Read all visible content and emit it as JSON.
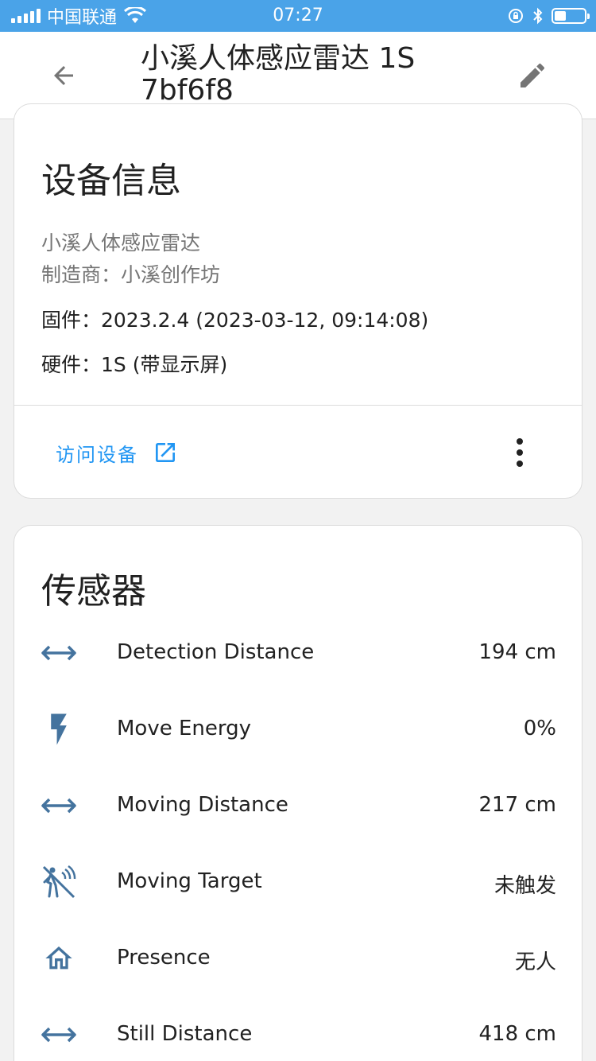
{
  "status_bar": {
    "carrier": "中国联通",
    "time": "07:27"
  },
  "app_bar": {
    "title": "小溪人体感应雷达 1S 7bf6f8"
  },
  "device_info": {
    "title": "设备信息",
    "model": "小溪人体感应雷达",
    "manufacturer": "制造商：小溪创作坊",
    "firmware": "固件：2023.2.4 (2023-03-12, 09:14:08)",
    "hardware": "硬件：1S (带显示屏)",
    "visit_label": "访问设备"
  },
  "sensors": {
    "title": "传感器",
    "items": [
      {
        "icon": "arrow-left-right-icon",
        "name": "Detection Distance",
        "value": "194 cm"
      },
      {
        "icon": "flash-icon",
        "name": "Move Energy",
        "value": "0%"
      },
      {
        "icon": "arrow-left-right-icon",
        "name": "Moving Distance",
        "value": "217 cm"
      },
      {
        "icon": "motion-sensor-off-icon",
        "name": "Moving Target",
        "value": "未触发"
      },
      {
        "icon": "home-outline-icon",
        "name": "Presence",
        "value": "无人"
      },
      {
        "icon": "arrow-left-right-icon",
        "name": "Still Distance",
        "value": "418 cm"
      }
    ]
  },
  "colors": {
    "status_bar": "#4aa3e8",
    "accent": "#2196f3",
    "icon": "#44739e"
  }
}
